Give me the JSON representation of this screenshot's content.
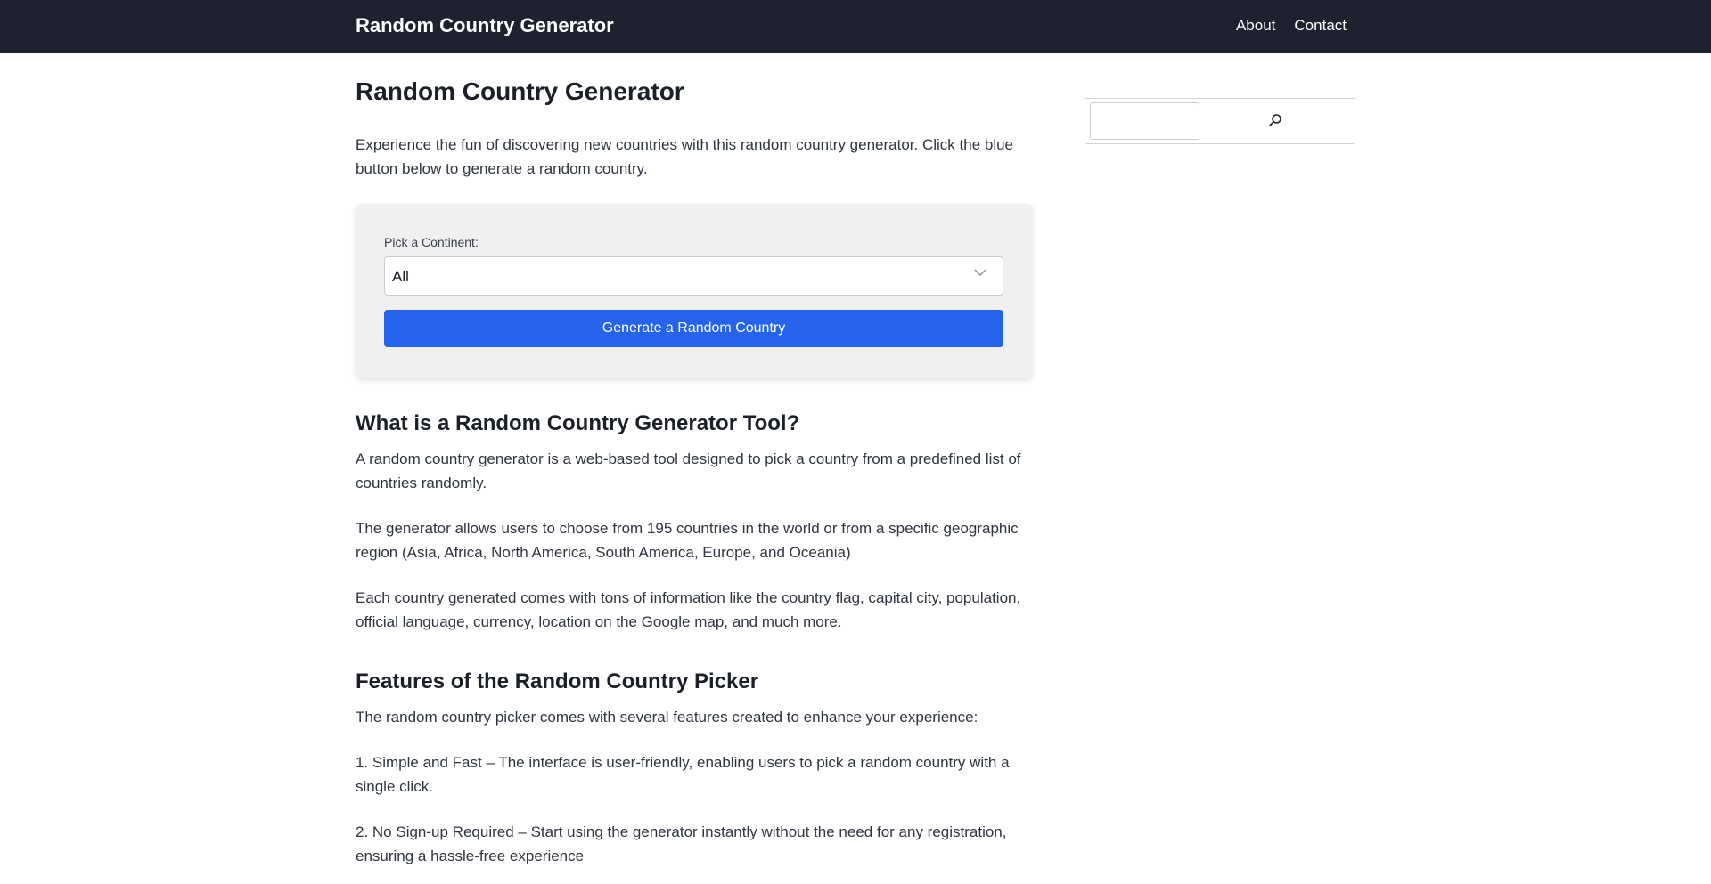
{
  "header": {
    "site_title": "Random Country Generator",
    "nav": [
      {
        "label": "About"
      },
      {
        "label": "Contact"
      }
    ]
  },
  "main": {
    "title": "Random Country Generator",
    "intro": "Experience the fun of discovering new countries with this random country generator. Click the blue button below to generate a random country.",
    "tool": {
      "continent_label": "Pick a Continent:",
      "continent_selected": "All",
      "generate_button": "Generate a Random Country"
    },
    "section1": {
      "heading": "What is a Random Country Generator Tool?",
      "paragraphs": [
        "A random country generator is a web-based tool designed to pick a country from a predefined list of countries randomly.",
        "The generator allows users to choose from 195 countries in the world or from a specific geographic region (Asia, Africa, North America, South America, Europe, and Oceania)",
        "Each country generated comes with tons of information like the country flag, capital city, population, official language, currency, location on the Google map, and much more."
      ]
    },
    "section2": {
      "heading": "Features of the Random Country Picker",
      "paragraphs": [
        "The random country picker comes with several features created to enhance your experience:",
        "1. Simple and Fast – The interface is user-friendly, enabling users to pick a random country with a single click.",
        "2. No Sign-up Required – Start using the generator instantly without the need for any registration, ensuring a hassle-free experience"
      ]
    }
  },
  "sidebar": {
    "search": {
      "placeholder": "",
      "button_icon": "search-icon"
    }
  },
  "colors": {
    "topbar": "#1e2230",
    "button": "#2563eb",
    "card": "#f0f0f0"
  }
}
